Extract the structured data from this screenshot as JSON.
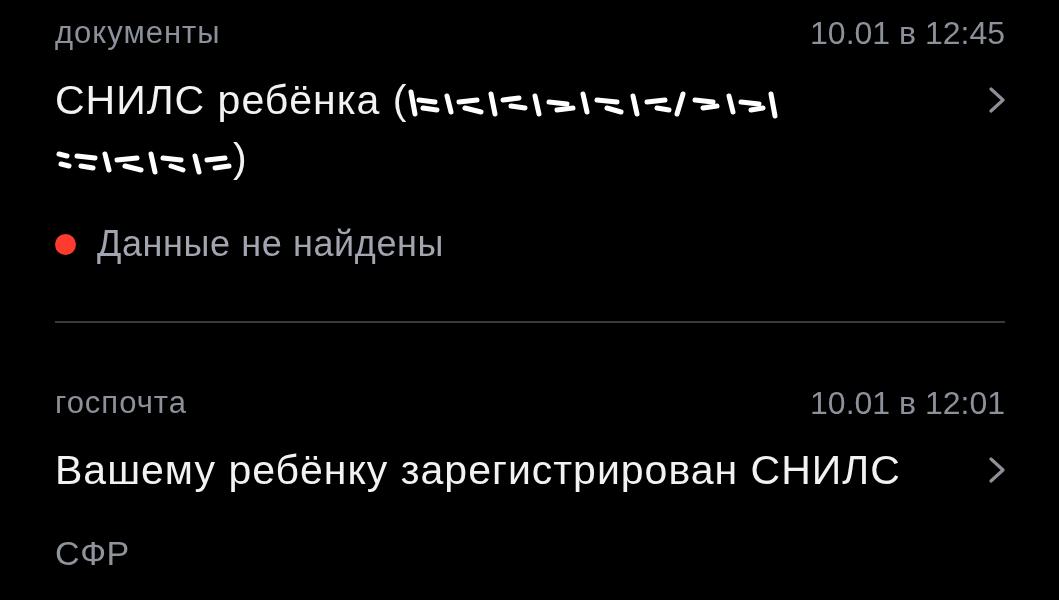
{
  "messages": [
    {
      "category": "документы",
      "date": "10.01 в 12:45",
      "title": "СНИЛС ребёнка (",
      "redacted": true,
      "title_tail": ")",
      "kind": "status",
      "status": {
        "text": "Данные не найдены",
        "color": "#ff3b30"
      }
    },
    {
      "category": "госпочта",
      "date": "10.01 в 12:01",
      "title": "Вашему ребёнку зарегистрирован СНИЛС",
      "redacted": false,
      "kind": "sender",
      "sender": "СФР"
    }
  ]
}
